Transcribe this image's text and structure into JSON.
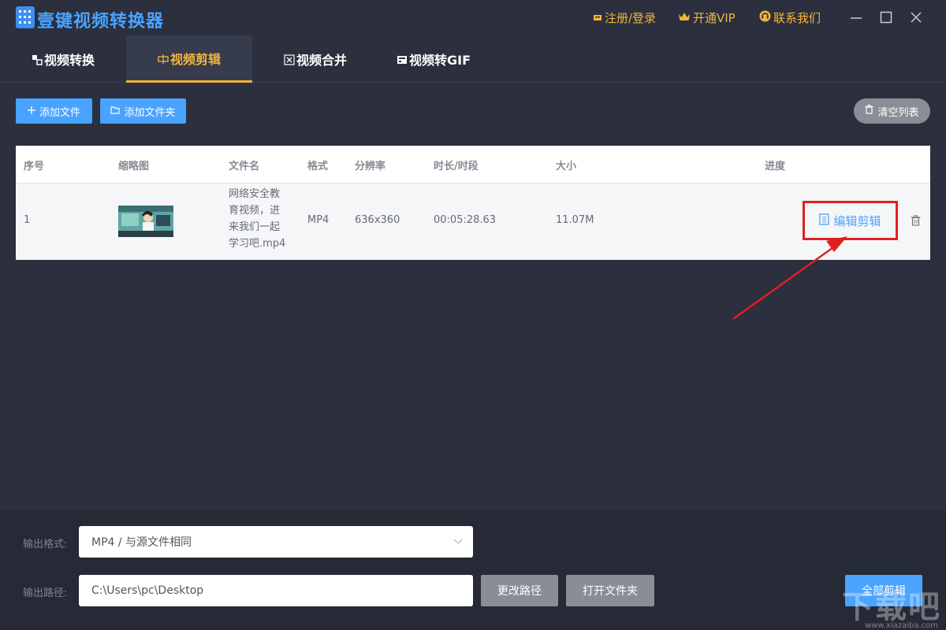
{
  "app": {
    "title": "壹键视频转换器"
  },
  "titlebar": {
    "register_login": "注册/登录",
    "open_vip": "开通VIP",
    "contact_us": "联系我们"
  },
  "tabs": [
    {
      "label": "视频转换",
      "icon": "convert-icon"
    },
    {
      "label": "视频剪辑",
      "icon": "clip-icon",
      "active": true
    },
    {
      "label": "视频合并",
      "icon": "merge-icon"
    },
    {
      "label": "视频转GIF",
      "icon": "gif-icon"
    }
  ],
  "toolbar": {
    "add_file": "添加文件",
    "add_folder": "添加文件夹",
    "clear_list": "清空列表"
  },
  "table": {
    "headers": [
      "序号",
      "缩略图",
      "文件名",
      "格式",
      "分辨率",
      "时长/时段",
      "大小",
      "进度"
    ],
    "rows": [
      {
        "index": "1",
        "filename_lines": [
          "网络安全教",
          "育视频，进",
          "来我们一起",
          "学习吧.mp4"
        ],
        "format": "MP4",
        "resolution": "636x360",
        "duration": "00:05:28.63",
        "size": "11.07M",
        "action": "编辑剪辑"
      }
    ]
  },
  "bottom": {
    "output_format_label": "输出格式:",
    "output_format_value": "MP4 / 与源文件相同",
    "output_path_label": "输出路径:",
    "output_path_value": "C:\\Users\\pc\\Desktop",
    "change_path": "更改路径",
    "open_folder": "打开文件夹",
    "clip_all": "全部剪辑"
  },
  "watermark": {
    "text": "下载吧",
    "url": "www.xiazaiba.com"
  },
  "colors": {
    "background": "#2b2f3e",
    "accent_blue": "#4aa3ff",
    "accent_gold": "#f3b53a",
    "highlight_red": "#e02020",
    "gray_button": "#8a8d96"
  }
}
